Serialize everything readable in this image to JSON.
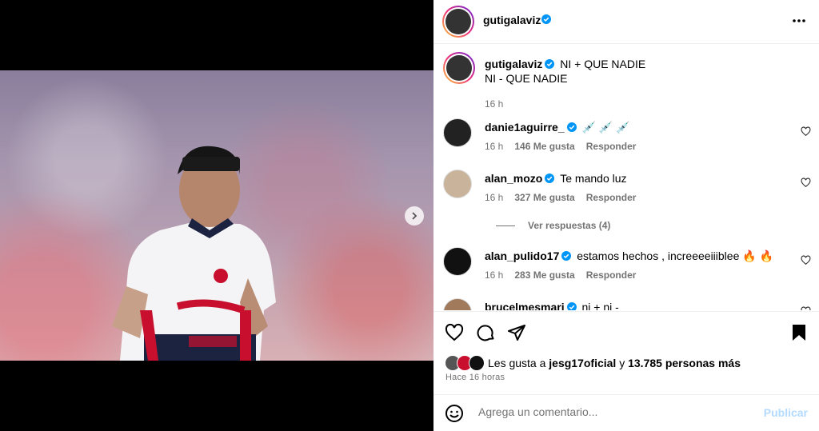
{
  "post": {
    "author": "gutigalaviz",
    "caption_line1": "NI + QUE NADIE",
    "caption_line2": "NI - QUE NADIE",
    "caption_time": "16 h",
    "likes_prefix": "Les gusta a",
    "likes_user": "jesg17oficial",
    "likes_join": "y",
    "likes_rest": "13.785 personas más",
    "posted_ago": "Hace 16 horas"
  },
  "comments": [
    {
      "user": "danie1aguirre_",
      "text": "💉 💉 💉",
      "time": "16 h",
      "likes": "146 Me gusta",
      "reply": "Responder"
    },
    {
      "user": "alan_mozo",
      "text": "Te mando luz",
      "time": "16 h",
      "likes": "327 Me gusta",
      "reply": "Responder",
      "view_replies": "Ver respuestas (4)"
    },
    {
      "user": "alan_pulido17",
      "text": "estamos hechos , increeeeiiiblee 🔥 🔥",
      "time": "16 h",
      "likes": "283 Me gusta",
      "reply": "Responder"
    },
    {
      "user": "brucelmesmari",
      "text": "ni + ni -"
    }
  ],
  "composer": {
    "placeholder": "Agrega un comentario...",
    "publish": "Publicar"
  },
  "colors": {
    "verified": "#0095f6",
    "publish_disabled": "#b3dbff",
    "muted": "#737373"
  },
  "icons": [
    "more-options-icon",
    "next-photo-icon",
    "like-icon",
    "comment-icon",
    "share-icon",
    "save-icon",
    "emoji-icon",
    "verified-icon"
  ]
}
